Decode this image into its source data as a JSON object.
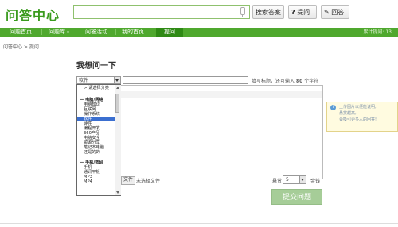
{
  "header": {
    "logo": "问答中心",
    "search_value": "",
    "search_button": "搜索答案",
    "ask_button": "提问",
    "answer_button": "回答"
  },
  "nav": {
    "items": [
      "问题首页",
      "问题库",
      "问答活动",
      "我的首页",
      "提问"
    ],
    "active": "提问",
    "count_label": "累计提问: 13"
  },
  "breadcrumb": "问答中心 > 提问",
  "form": {
    "title": "我想问一下",
    "category_selected": "软件",
    "title_value": "",
    "title_hint_prefix": "填写标题，还可输入",
    "title_hint_count": "80",
    "title_hint_suffix": "个字符",
    "file_button": "文件",
    "file_status": "未选择文件",
    "reward_label": "悬赏",
    "reward_value": "5",
    "reward_unit": "金钱",
    "submit": "提交问题"
  },
  "tip": {
    "line1": "上传图片以便能说明;",
    "line2": "悬赏越高,",
    "line3": "会吸引更多人的回答!"
  },
  "dropdown": {
    "options": [
      {
        "label": "> 请选择分类",
        "group": false
      },
      {
        "label": "",
        "group": false
      },
      {
        "label": "— 电脑/网络",
        "group": true
      },
      {
        "label": "电脑知识",
        "group": false
      },
      {
        "label": "互联网",
        "group": false
      },
      {
        "label": "操作系统",
        "group": false
      },
      {
        "label": "软件",
        "group": false,
        "selected": true
      },
      {
        "label": "硬件",
        "group": false
      },
      {
        "label": "编程开发",
        "group": false
      },
      {
        "label": "360产品",
        "group": false
      },
      {
        "label": "电脑安全",
        "group": false
      },
      {
        "label": "资源分享",
        "group": false
      },
      {
        "label": "笔记本电脑",
        "group": false
      },
      {
        "label": "还是的的",
        "group": false
      },
      {
        "label": "",
        "group": false
      },
      {
        "label": "— 手机/数码",
        "group": true
      },
      {
        "label": "手机",
        "group": false
      },
      {
        "label": "通讯平板",
        "group": false
      },
      {
        "label": "MP3",
        "group": false
      },
      {
        "label": "MP4",
        "group": false
      }
    ]
  }
}
